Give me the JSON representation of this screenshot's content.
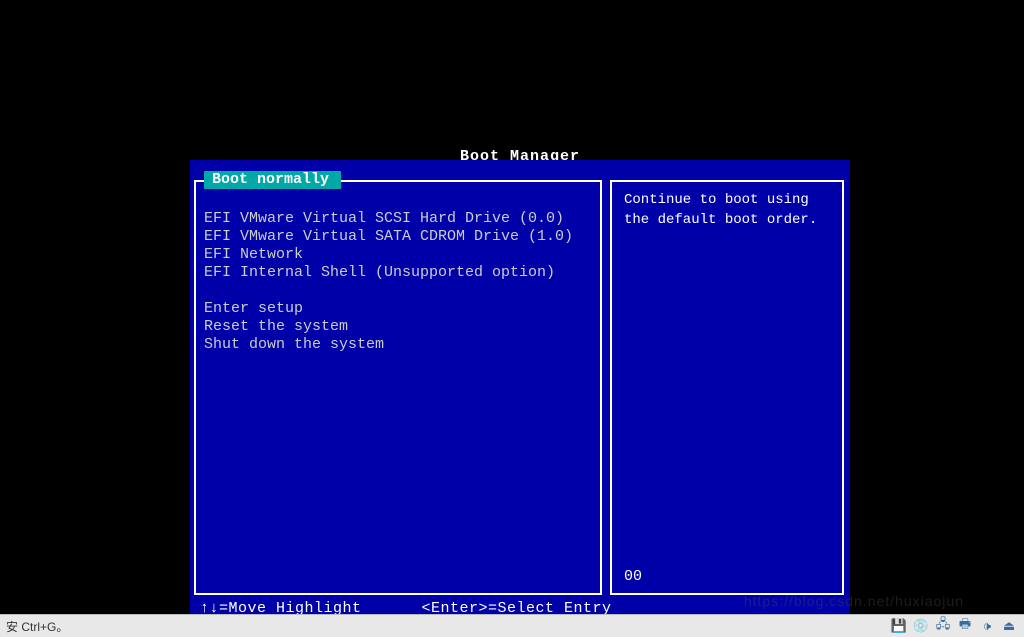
{
  "title": "Boot Manager",
  "selected": {
    "label": "Boot normally"
  },
  "boot_devices": [
    "EFI VMware Virtual SCSI Hard Drive (0.0)",
    "EFI VMware Virtual SATA CDROM Drive (1.0)",
    "EFI Network",
    "EFI Internal Shell (Unsupported option)"
  ],
  "system_actions": [
    "Enter setup",
    "Reset the system",
    "Shut down the system"
  ],
  "help": {
    "text": "Continue to boot using the default boot order.",
    "code": "00"
  },
  "footer": {
    "move": "↑↓=Move Highlight",
    "select": "<Enter>=Select Entry"
  },
  "statusbar": {
    "hint": "安 Ctrl+G。"
  },
  "watermark": "https://blog.csdn.net/huxiaojun"
}
